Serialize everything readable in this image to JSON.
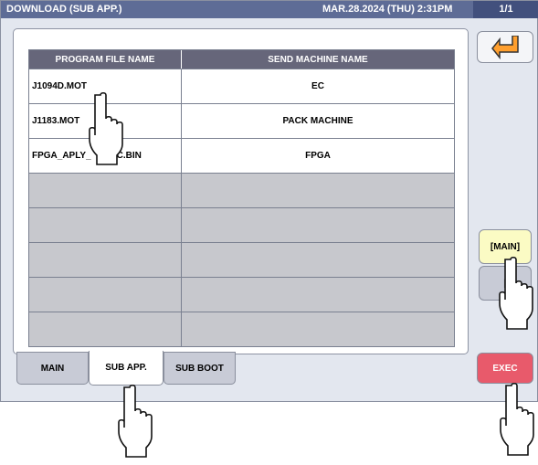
{
  "header": {
    "title": "DOWNLOAD (SUB APP.)",
    "datetime": "MAR.28.2024 (THU)  2:31PM",
    "page": "1/1"
  },
  "table": {
    "columns": [
      "PROGRAM FILE NAME",
      "SEND MACHINE NAME"
    ],
    "rows": [
      [
        "J1094D.MOT",
        "EC"
      ],
      [
        "J1183.MOT",
        "PACK MACHINE"
      ],
      [
        "FPGA_APLY_S",
        "C.BIN",
        "FPGA"
      ]
    ],
    "row3_name_left": "FPGA_APLY_",
    "row3_name_right": "C.BIN",
    "row3_machine": "FPGA",
    "empty_rows": 5
  },
  "tabs": {
    "main": "MAIN",
    "sub_app": "SUB APP.",
    "sub_boot": "SUB BOOT"
  },
  "side": {
    "back_icon": "return-arrow-icon",
    "main_label": "[MAIN]",
    "alt_label": "[",
    "exec_label": "EXEC"
  },
  "colors": {
    "title_bar": "#5e6c96",
    "header": "#66667a",
    "exec": "#e85a6b",
    "main_btn": "#fbfbc4"
  }
}
